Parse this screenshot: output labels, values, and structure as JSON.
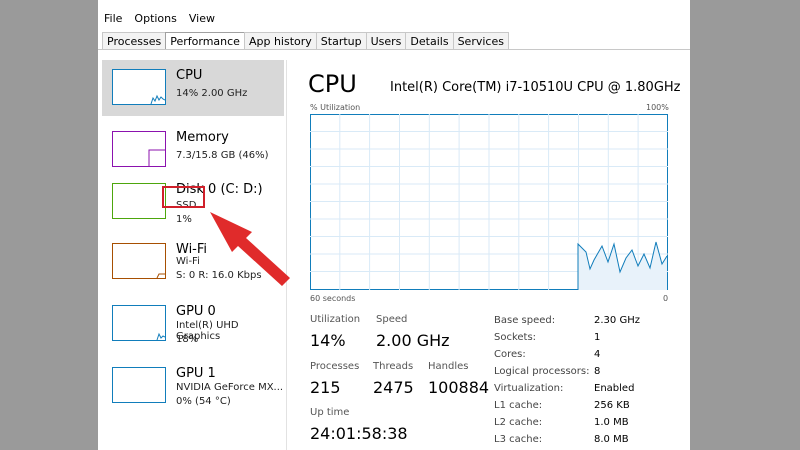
{
  "menu": [
    "File",
    "Options",
    "View"
  ],
  "tabs": [
    "Processes",
    "Performance",
    "App history",
    "Startup",
    "Users",
    "Details",
    "Services"
  ],
  "sidebar": {
    "items": [
      {
        "title": "CPU",
        "sub1": "14% 2.00 GHz",
        "sub2": ""
      },
      {
        "title": "Memory",
        "sub1": "7.3/15.8 GB (46%)",
        "sub2": ""
      },
      {
        "title": "Disk 0 (C: D:)",
        "sub1": "SSD",
        "sub2": "1%"
      },
      {
        "title": "Wi-Fi",
        "sub1": "Wi-Fi",
        "sub2": "S: 0 R: 16.0 Kbps"
      },
      {
        "title": "GPU 0",
        "sub1": "Intel(R) UHD Graphics",
        "sub2": "18%"
      },
      {
        "title": "GPU 1",
        "sub1": "NVIDIA GeForce MX...",
        "sub2": "0% (54 °C)"
      }
    ]
  },
  "main": {
    "title": "CPU",
    "model": "Intel(R) Core(TM) i7-10510U CPU @ 1.80GHz",
    "graph_top_left": "% Utilization",
    "graph_top_right": "100%",
    "graph_bottom_left": "60 seconds",
    "graph_bottom_right": "0"
  },
  "stats": {
    "utilization_label": "Utilization",
    "utilization": "14%",
    "speed_label": "Speed",
    "speed": "2.00 GHz",
    "processes_label": "Processes",
    "processes": "215",
    "threads_label": "Threads",
    "threads": "2475",
    "handles_label": "Handles",
    "handles": "100884",
    "uptime_label": "Up time",
    "uptime": "24:01:58:38"
  },
  "specs": [
    {
      "label": "Base speed:",
      "value": "2.30 GHz"
    },
    {
      "label": "Sockets:",
      "value": "1"
    },
    {
      "label": "Cores:",
      "value": "4"
    },
    {
      "label": "Logical processors:",
      "value": "8"
    },
    {
      "label": "Virtualization:",
      "value": "Enabled"
    },
    {
      "label": "L1 cache:",
      "value": "256 KB"
    },
    {
      "label": "L2 cache:",
      "value": "1.0 MB"
    },
    {
      "label": "L3 cache:",
      "value": "8.0 MB"
    }
  ],
  "colors": {
    "cpu": "#117dbb",
    "memory": "#8b12ae",
    "disk": "#4da60c",
    "wifi": "#a74f01",
    "gpu": "#117dbb",
    "annotation": "#d0202a"
  }
}
